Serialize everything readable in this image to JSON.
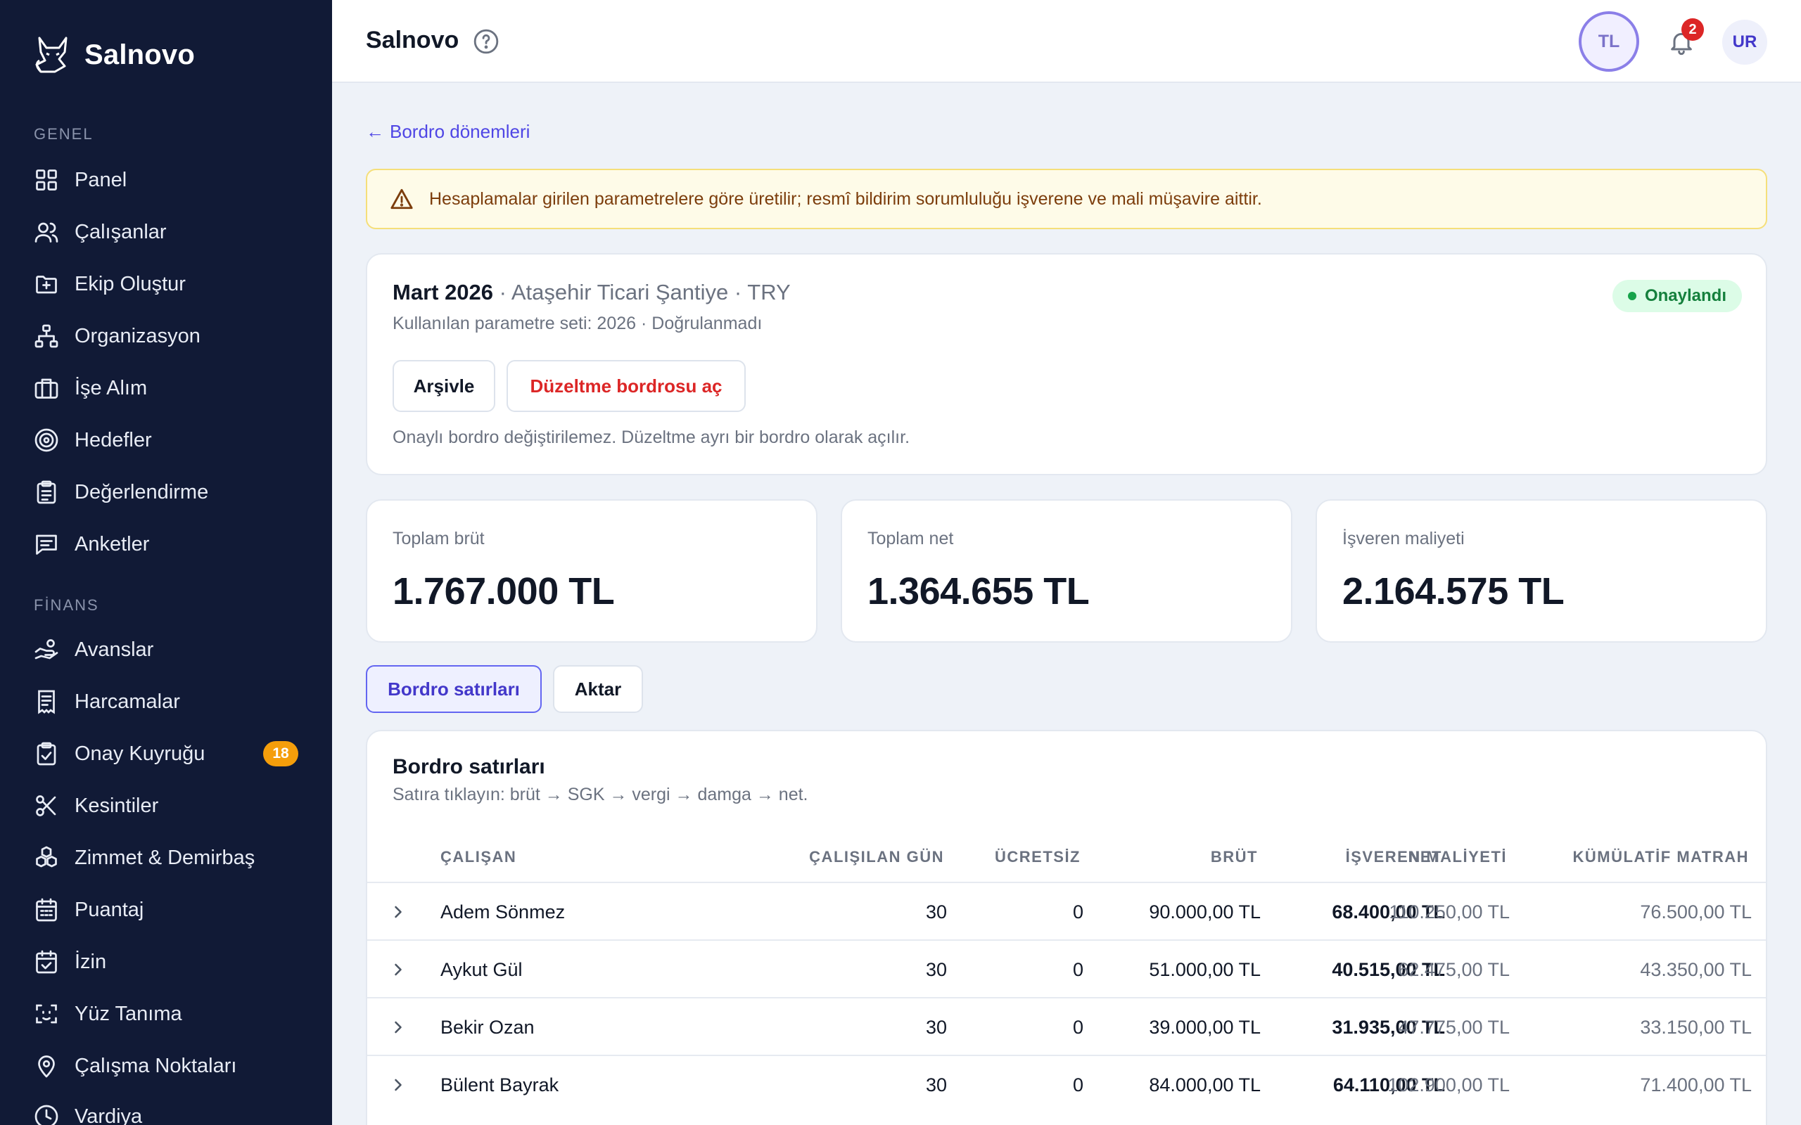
{
  "sidebar": {
    "brand": "Salnovo",
    "sections": [
      {
        "title": "GENEL",
        "items": [
          "Panel",
          "Çalışanlar",
          "Ekip Oluştur",
          "Organizasyon",
          "İşe Alım",
          "Hedefler",
          "Değerlendirme",
          "Anketler"
        ]
      },
      {
        "title": "FİNANS",
        "items": [
          "Avanslar",
          "Harcamalar",
          "Onay Kuyruğu",
          "Kesintiler",
          "Zimmet & Demirbaş",
          "Puantaj",
          "İzin",
          "Yüz Tanıma",
          "Çalışma Noktaları",
          "Vardiya"
        ]
      }
    ],
    "approval_badge": "18"
  },
  "header": {
    "title": "Salnovo",
    "avatar_tl": "TL",
    "notification_count": "2",
    "avatar_ur": "UR"
  },
  "back_link": "Bordro dönemleri",
  "warning": "Hesaplamalar girilen parametrelere göre üretilir; resmî bildirim sorumluluğu işverene ve mali müşavire aittir.",
  "period": {
    "month": "Mart 2026",
    "rest": " · Ataşehir Ticari Şantiye · TRY",
    "params": "Kullanılan parametre seti: 2026 · Doğrulanmadı",
    "status": "Onaylandı",
    "archive_label": "Arşivle",
    "correction_label": "Düzeltme bordrosu aç",
    "note": "Onaylı bordro değiştirilemez. Düzeltme ayrı bir bordro olarak açılır."
  },
  "stats": [
    {
      "label": "Toplam brüt",
      "value": "1.767.000 TL"
    },
    {
      "label": "Toplam net",
      "value": "1.364.655 TL"
    },
    {
      "label": "İşveren maliyeti",
      "value": "2.164.575 TL"
    }
  ],
  "tabs": {
    "active": "Bordro satırları",
    "inactive": "Aktar"
  },
  "table": {
    "title": "Bordro satırları",
    "subtitle": "Satıra tıklayın: brüt → SGK → vergi → damga → net.",
    "columns": [
      "ÇALIŞAN",
      "ÇALIŞILAN GÜN",
      "ÜCRETSİZ",
      "BRÜT",
      "NET",
      "İŞVEREN MALİYETİ",
      "KÜMÜLATİF MATRAH"
    ],
    "rows": [
      {
        "name": "Adem Sönmez",
        "days": "30",
        "unpaid": "0",
        "gross": "90.000,00 TL",
        "net": "68.400,00 TL",
        "employer": "110.250,00 TL",
        "cumulative": "76.500,00 TL"
      },
      {
        "name": "Aykut Gül",
        "days": "30",
        "unpaid": "0",
        "gross": "51.000,00 TL",
        "net": "40.515,00 TL",
        "employer": "62.475,00 TL",
        "cumulative": "43.350,00 TL"
      },
      {
        "name": "Bekir Ozan",
        "days": "30",
        "unpaid": "0",
        "gross": "39.000,00 TL",
        "net": "31.935,00 TL",
        "employer": "47.775,00 TL",
        "cumulative": "33.150,00 TL"
      },
      {
        "name": "Bülent Bayrak",
        "days": "30",
        "unpaid": "0",
        "gross": "84.000,00 TL",
        "net": "64.110,00 TL",
        "employer": "102.900,00 TL",
        "cumulative": "71.400,00 TL"
      }
    ]
  }
}
